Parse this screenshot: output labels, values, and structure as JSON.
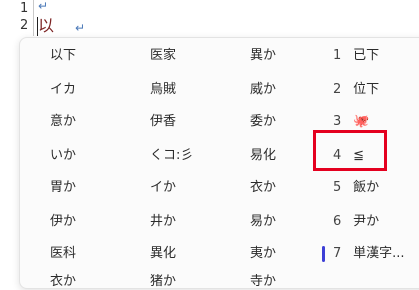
{
  "editor": {
    "line1_number": "1",
    "line2_number": "2",
    "return_mark": "↵",
    "ime_input": "以下"
  },
  "candidates": {
    "col1": [
      "以下",
      "イカ",
      "意か",
      "いか",
      "胃か",
      "伊か",
      "医科",
      "衣か"
    ],
    "col2": [
      "医家",
      "烏賊",
      "伊香",
      "くコ:彡",
      "イか",
      "井か",
      "異化",
      "猪か"
    ],
    "col3": [
      "異か",
      "威か",
      "委か",
      "易化",
      "衣か",
      "易か",
      "夷か",
      "寺か"
    ],
    "numbered": [
      {
        "num": "1",
        "text": "已下"
      },
      {
        "num": "2",
        "text": "位下"
      },
      {
        "num": "3",
        "text": "🐙"
      },
      {
        "num": "4",
        "text": "≦"
      },
      {
        "num": "5",
        "text": "飯か"
      },
      {
        "num": "6",
        "text": "尹か"
      },
      {
        "num": "7",
        "text": "単漢字..."
      }
    ]
  },
  "colors": {
    "highlight_box": "#e4001f",
    "selection_bar": "#3d3fd6",
    "ime_text": "#7d2424"
  }
}
